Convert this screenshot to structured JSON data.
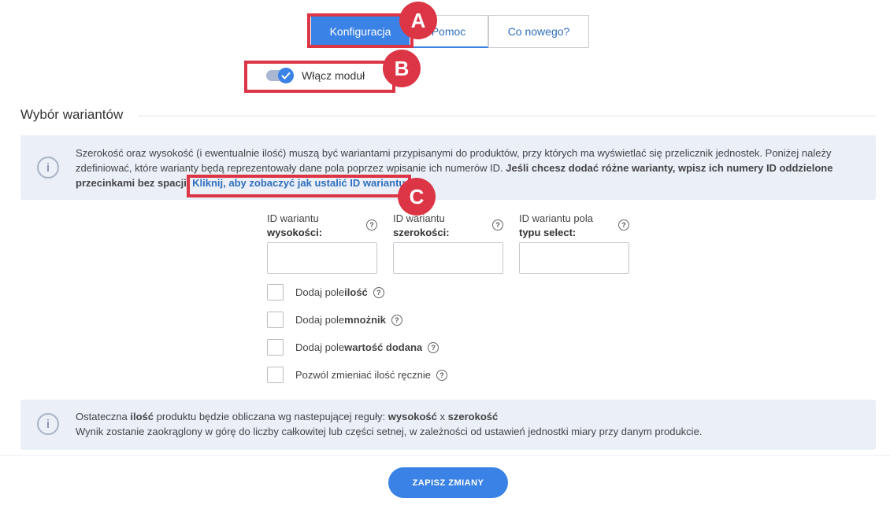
{
  "tabs": [
    {
      "label": "Konfiguracja"
    },
    {
      "label": "Pomoc"
    },
    {
      "label": "Co nowego?"
    }
  ],
  "toggle": {
    "label": "Włącz moduł",
    "enabled": true
  },
  "section": {
    "title": "Wybór wariantów"
  },
  "info1": {
    "text_a": "Szerokość oraz wysokość (i ewentualnie ilość) muszą być wariantami przypisanymi do produktów, przy których ma wyświetlać się przelicznik jednostek. Poniżej należy zdefiniować, które warianty będą reprezentowały dane pola poprzez wpisanie ich numerów ID. ",
    "text_bold": "Jeśli chcesz dodać różne warianty, wpisz ich numery ID oddzielone przecinkami bez spacji.",
    "link": "Kliknij, aby zobaczyć jak ustalić ID wariantu."
  },
  "fields": [
    {
      "label_line1": "ID wariantu",
      "label_line2": "wysokości:",
      "value": ""
    },
    {
      "label_line1": "ID wariantu",
      "label_line2": "szerokości:",
      "value": ""
    },
    {
      "label_line1": "ID wariantu pola",
      "label_line2": "typu select:",
      "value": ""
    }
  ],
  "checkboxes": [
    {
      "prefix": "Dodaj pole ",
      "bold": "ilość",
      "checked": false
    },
    {
      "prefix": "Dodaj pole ",
      "bold": "mnożnik",
      "checked": false
    },
    {
      "prefix": "Dodaj pole ",
      "bold": "wartość dodana",
      "checked": false
    },
    {
      "prefix": "Pozwól zmieniać ilość ręcznie",
      "bold": "",
      "checked": false
    }
  ],
  "info2": {
    "l1_a": "Ostateczna ",
    "l1_b": "ilość",
    "l1_c": " produktu będzie obliczana wg nastepującej reguły: ",
    "l1_d": "wysokość",
    "l1_e": " x ",
    "l1_f": "szerokość",
    "line2": "Wynik zostanie zaokrąglony w górę do liczby całkowitej lub części setnej, w zależności od ustawień jednostki miary przy danym produkcie."
  },
  "save_button": "ZAPISZ ZMIANY",
  "info_icon": "i",
  "help_icon": "?",
  "annotations": {
    "a": "A",
    "b": "B",
    "c": "C"
  },
  "colors": {
    "accent": "#3b82e6",
    "annotation": "#dc3545"
  }
}
